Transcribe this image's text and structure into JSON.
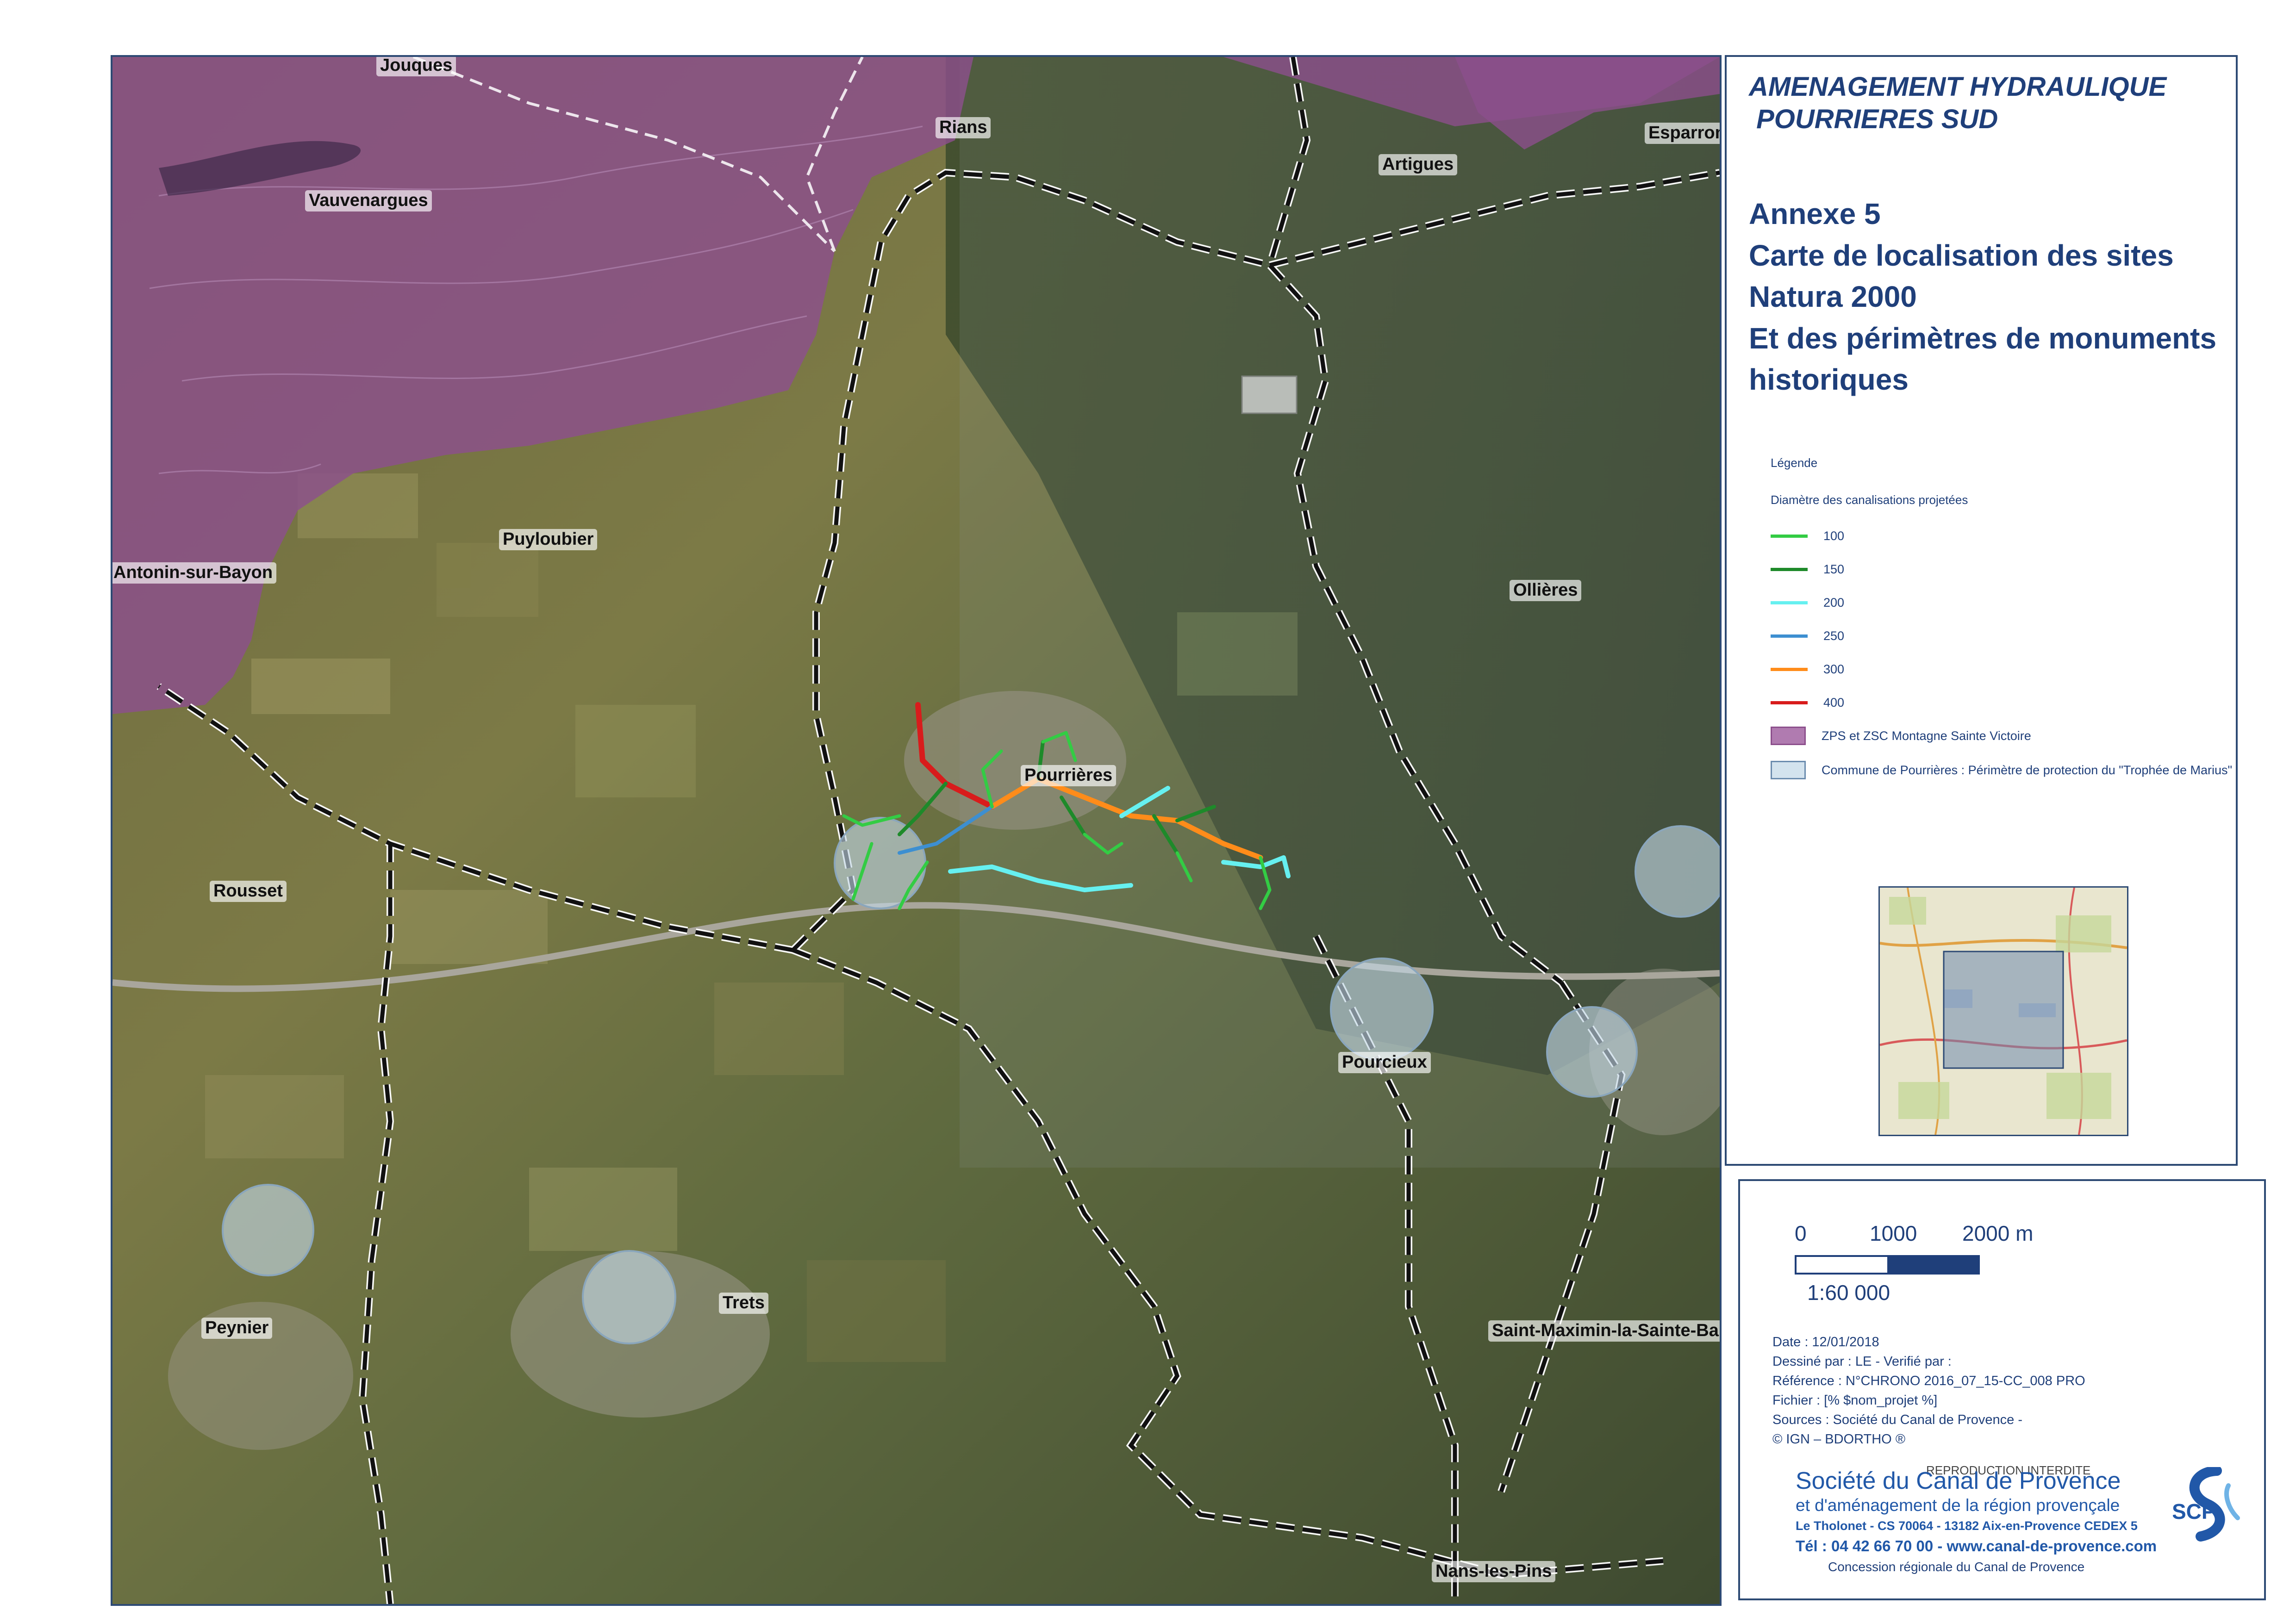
{
  "title": {
    "project_line1": "AMENAGEMENT HYDRAULIQUE",
    "project_line2": " POURRIERES SUD",
    "annex_lines": [
      "Annexe 5",
      "Carte de localisation des sites",
      "Natura 2000",
      "Et des périmètres de monuments",
      "historiques"
    ]
  },
  "places": {
    "jouques": "Jouques",
    "rians": "Rians",
    "artigues": "Artigues",
    "esparron": "Esparron",
    "vauvenargues": "Vauvenargues",
    "puyloubier": "Puyloubier",
    "antonin": "Antonin-sur-Bayon",
    "ollieres": "Ollières",
    "pourrieres": "Pourrières",
    "rousset": "Rousset",
    "pourcieux": "Pourcieux",
    "trets": "Trets",
    "peynier": "Peynier",
    "saint_maximin": "Saint-Maximin-la-Sainte-Bau",
    "nans": "Nans-les-Pins"
  },
  "legend": {
    "title": "Légende",
    "subtitle": "Diamètre des canalisations projetées",
    "pipes": [
      {
        "label": "100",
        "color": "#33cc44"
      },
      {
        "label": "150",
        "color": "#1e8a2a"
      },
      {
        "label": "200",
        "color": "#66f0f0"
      },
      {
        "label": "250",
        "color": "#3d8fd1"
      },
      {
        "label": "300",
        "color": "#ff8c1a"
      },
      {
        "label": "400",
        "color": "#d81c1c"
      }
    ],
    "zones": [
      {
        "label": "ZPS et ZSC Montagne Sainte Victoire",
        "color": "#b07bb0"
      },
      {
        "label": "Commune de Pourrières : Périmètre de protection du \"Trophée de Marius\"",
        "color": "#d3e3ee"
      }
    ]
  },
  "scale": {
    "label_0": "0",
    "label_1000": "1000",
    "label_2000": "2000 m",
    "ratio": "1:60 000"
  },
  "meta": {
    "date": "Date : 12/01/2018",
    "author": "Dessiné par : LE - Verifié par :",
    "reference": "Référence : N°CHRONO 2016_07_15-CC_008 PRO",
    "file": "Fichier : [% $nom_projet %]",
    "sources": "Sources : Société du Canal de Provence -",
    "ign": "© IGN – BDORTHO ®"
  },
  "company": {
    "reproduction": "REPRODUCTION INTERDITE",
    "name": "Société du Canal de Provence",
    "subtitle": "et d'aménagement de la région provençale",
    "address": "Le Tholonet - CS 70064 - 13182 Aix-en-Provence CEDEX 5",
    "phone": "Tél : 04 42 66 70 00 - www.canal-de-provence.com",
    "concession": "Concession régionale du  Canal de Provence",
    "logo_text": "SCP"
  },
  "colors": {
    "frame": "#2d4a74",
    "title_text": "#1f3f7a",
    "natura_zone": "#8c4f8c",
    "protection_circle": "#c3d8e6",
    "scp_blue": "#2158a8"
  }
}
